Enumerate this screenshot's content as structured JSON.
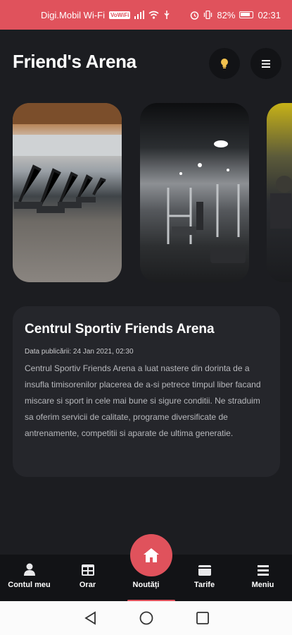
{
  "status_bar": {
    "carrier": "Digi.Mobil Wi-Fi",
    "volte_badge": "VoWiFi",
    "battery_percent": "82%",
    "time": "02:31",
    "icons": [
      "signal-icon",
      "wifi-icon",
      "usb-icon",
      "alarm-icon",
      "vibrate-icon",
      "battery-icon"
    ]
  },
  "header": {
    "title": "Friend's Arena",
    "bulb_icon": "bulb-icon",
    "menu_icon": "list-icon"
  },
  "carousel": {
    "images": [
      {
        "name": "gym-cardio-area-photo"
      },
      {
        "name": "gym-weights-area-photo"
      },
      {
        "name": "gym-training-photo"
      }
    ]
  },
  "article": {
    "title": "Centrul Sportiv Friends Arena",
    "date": "Data publicării: 24 Jan 2021, 02:30",
    "body": "Centrul Sportiv Friends Arena a luat nastere din dorinta de a insufla timisorenilor placerea de a-si petrece timpul liber facand miscare si sport in cele mai bune si sigure conditii. Ne straduim sa oferim servicii de calitate, programe diversificate de antrenamente, competitii si aparate de ultima generatie."
  },
  "bottom_nav": {
    "items": [
      {
        "label": "Contul meu",
        "icon": "user-icon"
      },
      {
        "label": "Orar",
        "icon": "calendar-icon"
      },
      {
        "label": "Noutăți",
        "icon": "home-icon",
        "active": true
      },
      {
        "label": "Tarife",
        "icon": "wallet-icon"
      },
      {
        "label": "Meniu",
        "icon": "menu-icon"
      }
    ]
  },
  "colors": {
    "accent": "#e0525c",
    "background": "#1c1d21",
    "card": "#25262b"
  }
}
